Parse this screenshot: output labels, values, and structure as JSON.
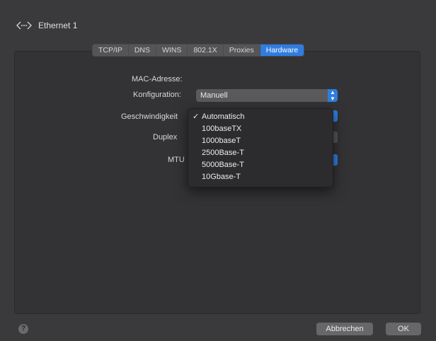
{
  "header": {
    "title": "Ethernet 1",
    "icon": "network-arrows-icon"
  },
  "tabs": [
    {
      "label": "TCP/IP",
      "active": false
    },
    {
      "label": "DNS",
      "active": false
    },
    {
      "label": "WINS",
      "active": false
    },
    {
      "label": "802.1X",
      "active": false
    },
    {
      "label": "Proxies",
      "active": false
    },
    {
      "label": "Hardware",
      "active": true
    }
  ],
  "form": {
    "mac_label": "MAC-Adresse:",
    "config_label": "Konfiguration:",
    "config_value": "Manuell",
    "speed_label": "Geschwindigkeit",
    "duplex_label": "Duplex",
    "mtu_label": "MTU"
  },
  "speed_menu": {
    "selected": "Automatisch",
    "items": [
      {
        "label": "Automatisch",
        "checked": true
      },
      {
        "label": "100baseTX",
        "checked": false
      },
      {
        "label": "1000baseT",
        "checked": false
      },
      {
        "label": "2500Base-T",
        "checked": false
      },
      {
        "label": "5000Base-T",
        "checked": false
      },
      {
        "label": "10Gbase-T",
        "checked": false
      }
    ]
  },
  "footer": {
    "help": "?",
    "cancel_label": "Abbrechen",
    "ok_label": "OK"
  },
  "colors": {
    "accent": "#2f7de0",
    "background": "#3a3a3c"
  }
}
